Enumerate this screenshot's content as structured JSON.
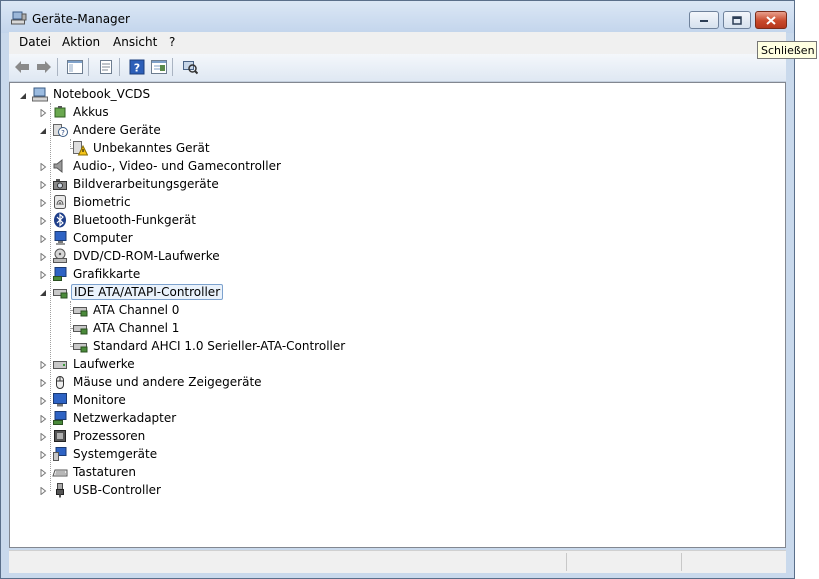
{
  "window": {
    "title": "Geräte-Manager",
    "tooltip": "Schließen"
  },
  "menubar": {
    "items": [
      "Datei",
      "Aktion",
      "Ansicht",
      "?"
    ]
  },
  "toolbar": {
    "buttons": [
      "back-icon",
      "forward-icon",
      "show-hide-tree-icon",
      "properties-icon",
      "help-icon",
      "view-icon",
      "scan-hardware-icon"
    ]
  },
  "tree": {
    "root": "Notebook_VCDS",
    "items": [
      {
        "label": "Akkus",
        "icon": "battery-icon",
        "expanded": false
      },
      {
        "label": "Andere Geräte",
        "icon": "unknown-device-icon",
        "expanded": true,
        "children": [
          "Unbekanntes Gerät"
        ]
      },
      {
        "label": "Audio-, Video- und Gamecontroller",
        "icon": "speaker-icon",
        "expanded": false
      },
      {
        "label": "Bildverarbeitungsgeräte",
        "icon": "camera-icon",
        "expanded": false
      },
      {
        "label": "Biometric",
        "icon": "fingerprint-icon",
        "expanded": false
      },
      {
        "label": "Bluetooth-Funkgerät",
        "icon": "bluetooth-icon",
        "expanded": false
      },
      {
        "label": "Computer",
        "icon": "computer-icon",
        "expanded": false
      },
      {
        "label": "DVD/CD-ROM-Laufwerke",
        "icon": "dvd-drive-icon",
        "expanded": false
      },
      {
        "label": "Grafikkarte",
        "icon": "display-adapter-icon",
        "expanded": false
      },
      {
        "label": "IDE ATA/ATAPI-Controller",
        "icon": "ide-controller-icon",
        "expanded": true,
        "selected": true,
        "children": [
          "ATA Channel 0",
          "ATA Channel 1",
          "Standard AHCI 1.0 Serieller-ATA-Controller"
        ]
      },
      {
        "label": "Laufwerke",
        "icon": "disk-drive-icon",
        "expanded": false
      },
      {
        "label": "Mäuse und andere Zeigegeräte",
        "icon": "mouse-icon",
        "expanded": false
      },
      {
        "label": "Monitore",
        "icon": "monitor-icon",
        "expanded": false
      },
      {
        "label": "Netzwerkadapter",
        "icon": "network-adapter-icon",
        "expanded": false
      },
      {
        "label": "Prozessoren",
        "icon": "processor-icon",
        "expanded": false
      },
      {
        "label": "Systemgeräte",
        "icon": "system-devices-icon",
        "expanded": false
      },
      {
        "label": "Tastaturen",
        "icon": "keyboard-icon",
        "expanded": false
      },
      {
        "label": "USB-Controller",
        "icon": "usb-icon",
        "expanded": false
      }
    ]
  },
  "colors": {
    "window_frame": "#c9d9ec",
    "close_button": "#c94a2c",
    "selection_border": "#7da2ce",
    "selection_fill": "#eaf2fb",
    "tooltip_bg": "#ffffe1"
  }
}
